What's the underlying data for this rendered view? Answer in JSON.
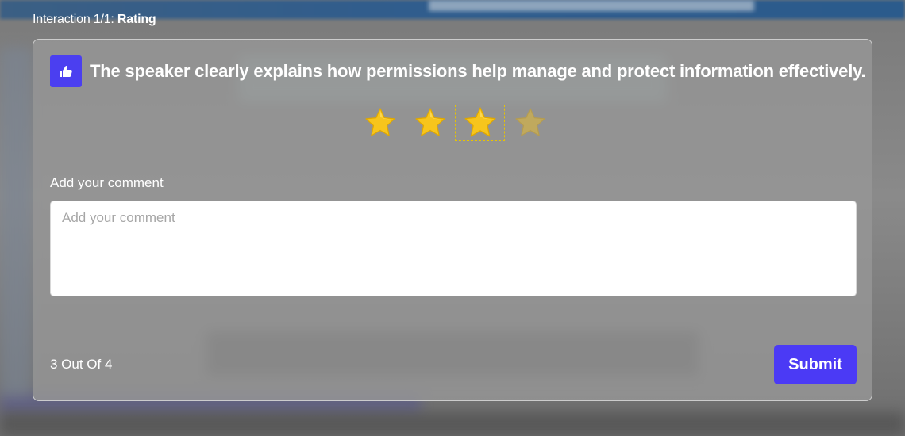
{
  "header": {
    "prefix": "Interaction 1/1: ",
    "type": "Rating"
  },
  "question": {
    "text": "The speaker clearly explains how permissions help manage and protect information effectively.",
    "icon": "thumbs-up-icon"
  },
  "rating": {
    "value": 3,
    "max": 4,
    "star_color": "#f5c518"
  },
  "comment": {
    "label": "Add your comment",
    "placeholder": "Add your comment",
    "value": ""
  },
  "footer": {
    "progress_text": "3 Out Of 4",
    "submit_label": "Submit"
  },
  "colors": {
    "accent": "#4b3af5"
  }
}
